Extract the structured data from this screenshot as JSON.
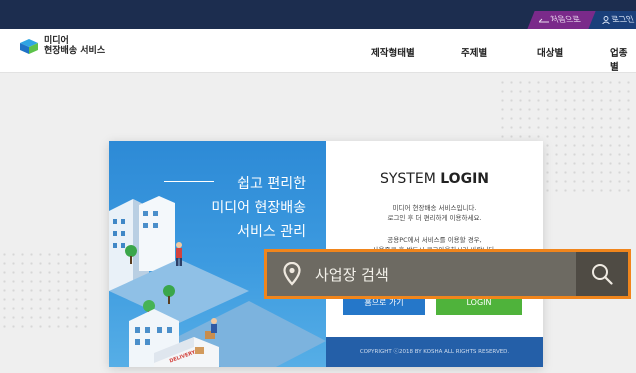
{
  "topbar": {
    "home_tab": "처음으로",
    "login_tab": "로그인"
  },
  "header": {
    "logo_line1": "미디어",
    "logo_line2": "현장배송 서비스",
    "nav": [
      "제작형태별",
      "주제별",
      "대상별",
      "업종별"
    ]
  },
  "card": {
    "tagline": [
      "쉽고 편리한",
      "미디어 현장배송",
      "서비스 관리"
    ],
    "title_prefix": "SYSTEM",
    "title_bold": "LOGIN",
    "desc_line1": "미디어 현장배송 서비스입니다.",
    "desc_line2": "로그인 후 더 편리하게 이용하세요.",
    "notice_line1": "공용PC에서 서비스를 이용할 경우,",
    "notice_line2": "사용종료 후 반드시 로그아웃하시기 바랍니다.",
    "home_button": "홈으로 가기",
    "login_button": "LOGIN",
    "copyright": "COPYRIGHT ⓒ2018 BY KOSHA ALL RIGHTS RESERVED.",
    "truck_label": "DELIVERY"
  },
  "search": {
    "placeholder": "사업장 검색"
  },
  "colors": {
    "topbar": "#1c2d4f",
    "accent_orange": "#f0851c",
    "login_green": "#4fb33b",
    "home_blue": "#2577c9"
  }
}
